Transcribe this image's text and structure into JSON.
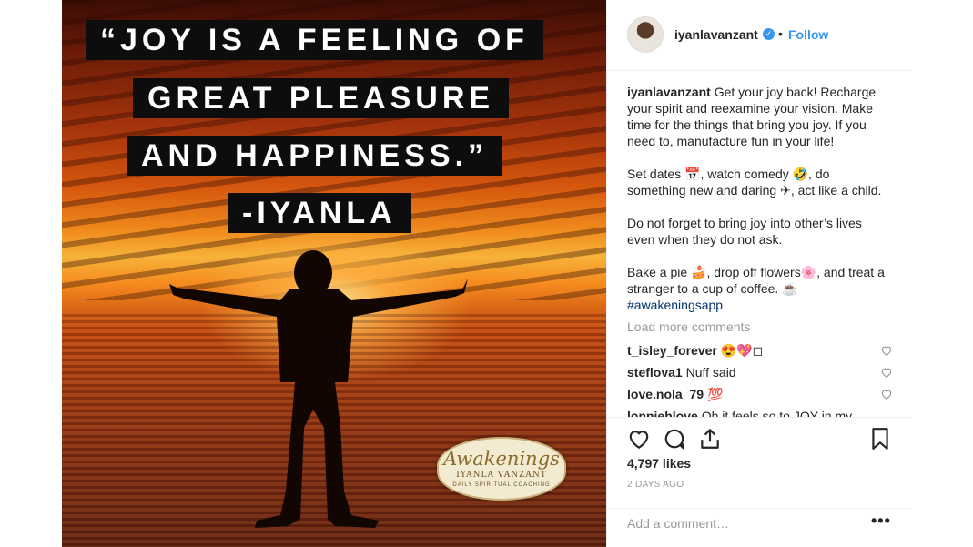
{
  "post": {
    "quote_lines": [
      "“JOY IS A FEELING OF",
      "GREAT PLEASURE",
      "AND HAPPINESS.”",
      "-IYANLA"
    ],
    "badge": {
      "brand": "Awakenings",
      "name": "IYANLA VANZANT",
      "tagline": "DAILY SPIRITUAL COACHING"
    }
  },
  "header": {
    "username": "iyanlavanzant",
    "verified_icon": "verified-badge-icon",
    "separator": "•",
    "follow_label": "Follow"
  },
  "caption": {
    "username": "iyanlavanzant",
    "p1": "Get your joy back! Recharge your spirit and reexamine your vision. Make time for the things that bring you joy. If you need to, manufacture fun in your life!",
    "p2": "Set dates 📅, watch comedy 🤣, do something new and daring ✈, act like a child.",
    "p3": "Do not forget to bring joy into other’s lives even when they do not ask.",
    "p4": "Bake a pie 🍰, drop off flowers🌸, and treat a stranger to a cup of coffee. ☕",
    "hashtag": "#awakeningsapp"
  },
  "load_more": "Load more comments",
  "comments": [
    {
      "user": "t_isley_forever",
      "text": "😍💖◻"
    },
    {
      "user": "steflova1",
      "text": "Nuff said"
    },
    {
      "user": "love.nola_79",
      "text": "💯"
    },
    {
      "user": "lonniehlove",
      "text": "Oh it feels so to JOY in my"
    }
  ],
  "actions": {
    "likes": "4,797 likes",
    "time": "2 DAYS AGO",
    "add_comment_placeholder": "Add a comment…",
    "more": "•••"
  },
  "colors": {
    "accent": "#3897f0",
    "hashtag": "#003569",
    "muted": "#999999"
  }
}
